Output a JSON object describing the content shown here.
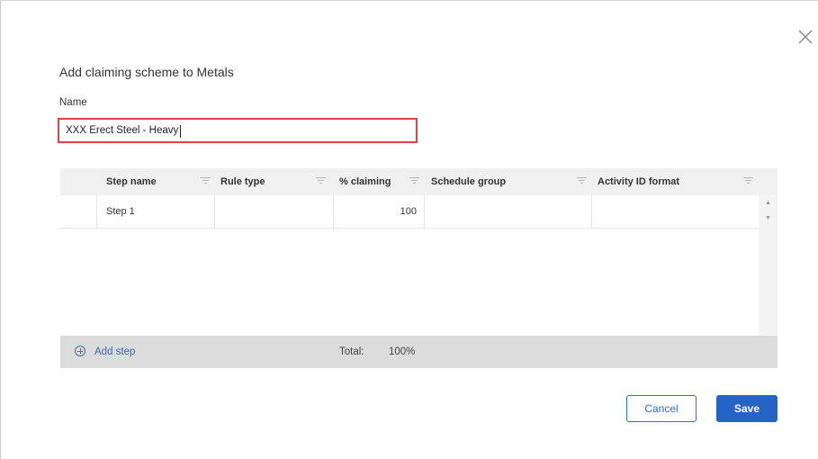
{
  "dialog": {
    "title": "Add claiming scheme to Metals",
    "name_label": "Name",
    "name_value": "XXX Erect Steel - Heavy",
    "close_icon": "close-icon"
  },
  "grid": {
    "columns": [
      {
        "label": "Step name"
      },
      {
        "label": "Rule type"
      },
      {
        "label": "% claiming"
      },
      {
        "label": "Schedule group"
      },
      {
        "label": "Activity ID format"
      }
    ],
    "rows": [
      {
        "step_name": "Step 1",
        "rule_type": "",
        "claiming": "100",
        "schedule_group": "",
        "activity_id_format": ""
      }
    ],
    "footer": {
      "add_step_label": "Add step",
      "total_label": "Total:",
      "total_value": "100%"
    }
  },
  "buttons": {
    "cancel_label": "Cancel",
    "save_label": "Save"
  },
  "colors": {
    "accent": "#2563c7",
    "input_highlight": "#e0434a",
    "header_bg": "#f0f0f0",
    "footer_bg": "#dcdcdc"
  }
}
